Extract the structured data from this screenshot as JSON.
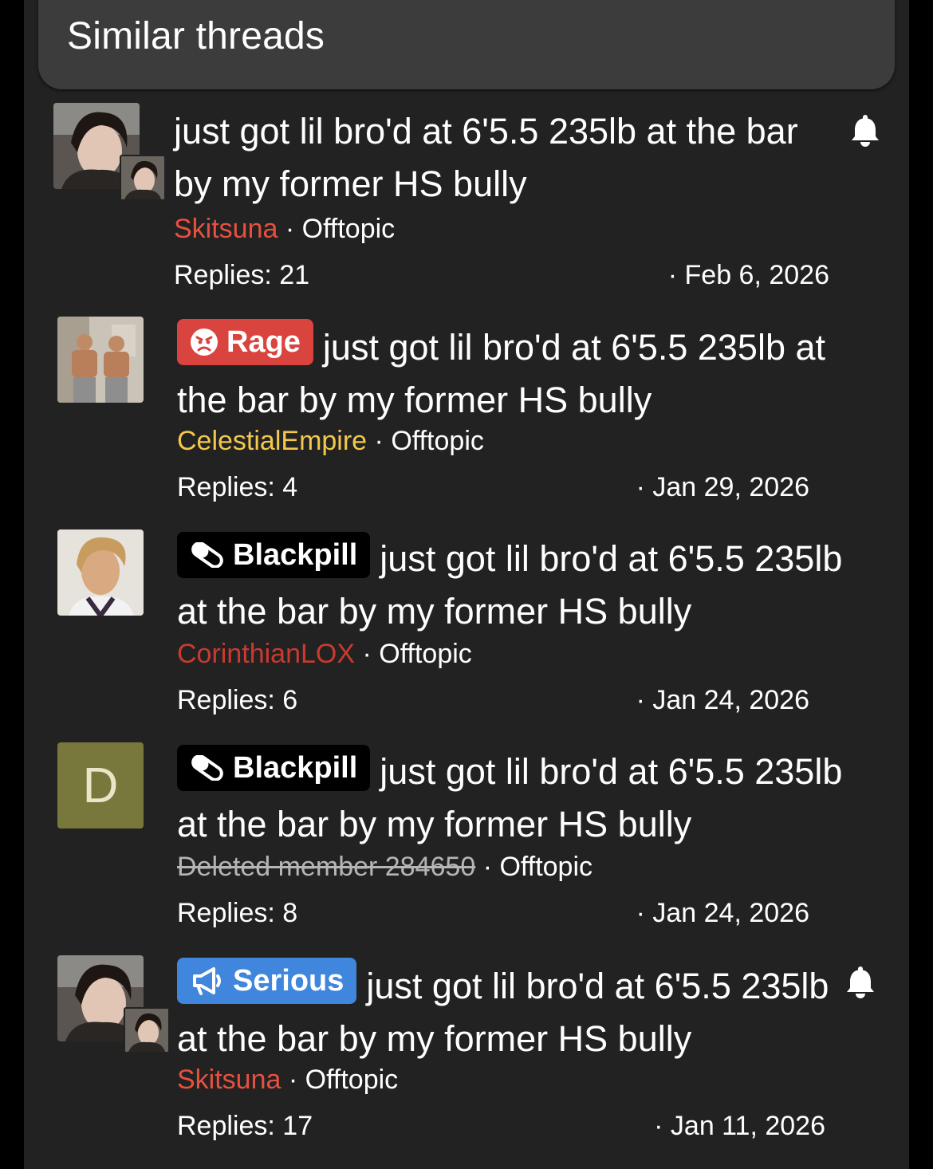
{
  "header": {
    "title": "Similar threads"
  },
  "threads": [
    {
      "title": "just got lil bro'd at 6'5.5 235lb at the bar by my former HS bully",
      "prefix": "",
      "author": "Skitsuna",
      "forum": "Offtopic",
      "replies_label": "Replies: 21",
      "date": "· Feb 6, 2026",
      "watched": true,
      "avatar_icon": "user-photo-avatar"
    },
    {
      "title": "just got lil bro'd at 6'5.5 235lb at the bar by my former HS bully",
      "prefix": "Rage",
      "prefix_icon": "angry-face-icon",
      "author": "CelestialEmpire",
      "forum": "Offtopic",
      "replies_label": "Replies: 4",
      "date": "· Jan 29, 2026",
      "watched": false,
      "avatar_icon": "user-photo-avatar"
    },
    {
      "title": "just got lil bro'd at 6'5.5 235lb at the bar by my former HS bully",
      "prefix": "Blackpill",
      "prefix_icon": "pill-icon",
      "author": "CorinthianLOX",
      "forum": "Offtopic",
      "replies_label": "Replies: 6",
      "date": "· Jan 24, 2026",
      "watched": false,
      "avatar_icon": "user-photo-avatar"
    },
    {
      "title": "just got lil bro'd at 6'5.5 235lb at the bar by my former HS bully",
      "prefix": "Blackpill",
      "prefix_icon": "pill-icon",
      "author": "Deleted member 284650",
      "forum": "Offtopic",
      "replies_label": "Replies: 8",
      "date": "· Jan 24, 2026",
      "watched": false,
      "avatar_letter": "D"
    },
    {
      "title": "just got lil bro'd at 6'5.5 235lb at the bar by my former HS bully",
      "prefix": "Serious",
      "prefix_icon": "megaphone-icon",
      "author": "Skitsuna",
      "forum": "Offtopic",
      "replies_label": "Replies: 17",
      "date": "· Jan 11, 2026",
      "watched": true,
      "avatar_icon": "user-photo-avatar"
    }
  ],
  "separator": "·",
  "colors": {
    "panel_bg": "#222222",
    "header_bg": "#3c3c3c",
    "rage": "#d9443f",
    "blackpill": "#000000",
    "serious": "#3f86dc",
    "user_skitsuna": "#e8503f",
    "user_celestial": "#f2c94c",
    "user_corinthian": "#c93a30",
    "avatar_letter_bg": "#78783c"
  }
}
